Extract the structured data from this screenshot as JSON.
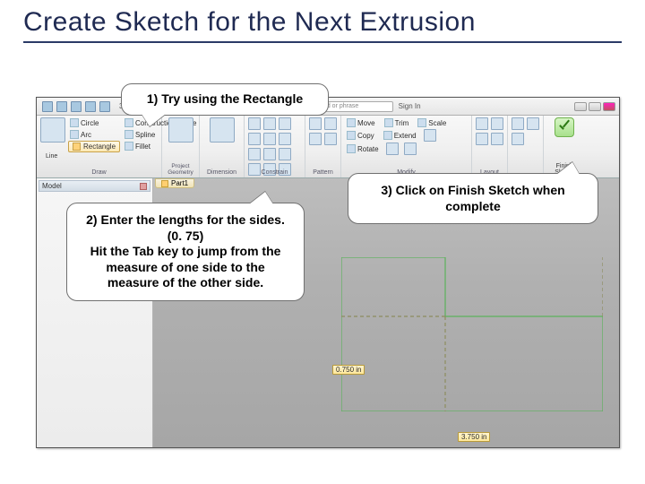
{
  "title": "Create Sketch for the Next Extrusion",
  "callouts": {
    "c1": "1) Try using the Rectangle",
    "c2": "2) Enter the lengths for the sides. (0. 75)\nHit the Tab key to jump from the measure of one side to the measure of the other side.",
    "c3": "3) Click on Finish Sketch when complete"
  },
  "titlebar": {
    "search_placeholder": "keyword or phrase",
    "signin": "Sign In"
  },
  "ribbon": {
    "tab": "3D Model",
    "draw": {
      "line": "Line",
      "circle": "Circle",
      "arc": "Arc",
      "spline": "Spline",
      "rectangle": "Rectangle",
      "construction": "Construction Curve",
      "fillet": "Fillet",
      "group": "Draw"
    },
    "project": {
      "label": "Project Geometry",
      "group": ""
    },
    "dimension": {
      "label": "Dimension",
      "group": "Constrain"
    },
    "pattern": {
      "group": "Pattern"
    },
    "modify": {
      "move": "Move",
      "copy": "Copy",
      "rotate": "Rotate",
      "trim": "Trim",
      "extend": "Extend",
      "scale": "Scale",
      "group": "Modify"
    },
    "layout": {
      "group": "Layout"
    },
    "finish": {
      "l1": "Finish",
      "l2": "Sketch"
    }
  },
  "browser": {
    "header": "Model",
    "part_tab": "Part1"
  },
  "dims": {
    "d1": "0.750 in",
    "d2": "3.750 in"
  }
}
